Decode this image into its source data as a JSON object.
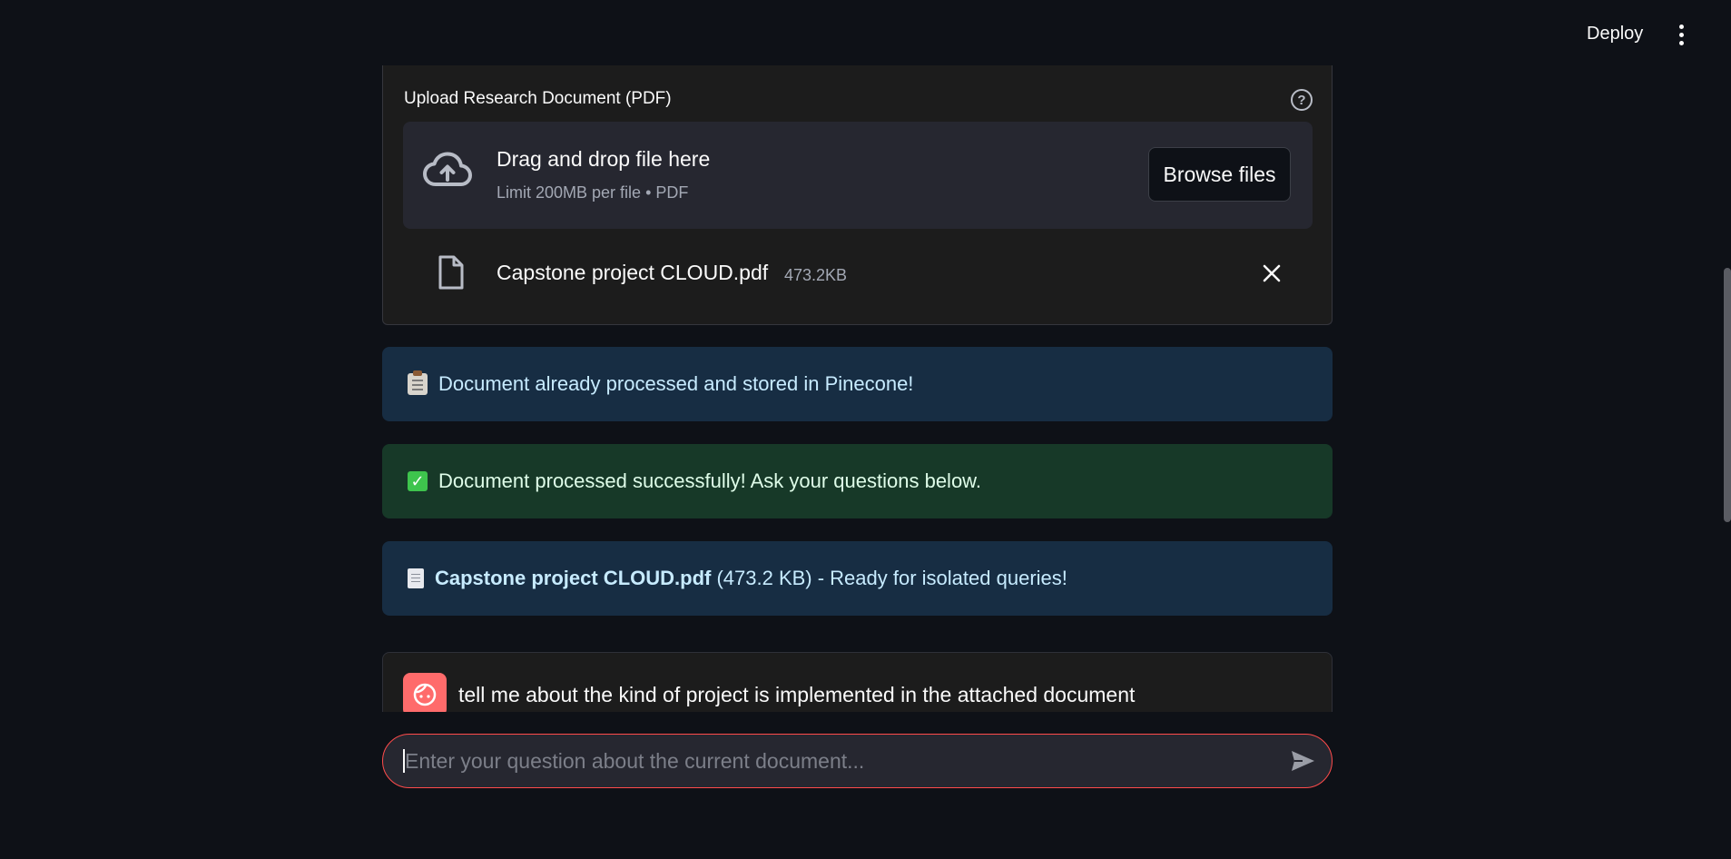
{
  "header": {
    "deploy_label": "Deploy",
    "menu_icon": "more-vertical-icon"
  },
  "uploader": {
    "label": "Upload Research Document (PDF)",
    "help_icon": "help-circle-icon",
    "dropzone_title": "Drag and drop file here",
    "dropzone_subtitle": "Limit 200MB per file • PDF",
    "browse_label": "Browse files",
    "cloud_icon": "cloud-upload-icon",
    "file": {
      "name": "Capstone project CLOUD.pdf",
      "size": "473.2KB",
      "icon": "file-icon",
      "remove_icon": "close-icon"
    }
  },
  "alerts": [
    {
      "type": "info",
      "icon": "clipboard-icon",
      "text": "Document already processed and stored in Pinecone!"
    },
    {
      "type": "success",
      "icon": "check-icon",
      "text": "Document processed successfully! Ask your questions below."
    },
    {
      "type": "info",
      "icon": "document-icon",
      "bold_text": "Capstone project CLOUD.pdf",
      "text": " (473.2 KB) - Ready for isolated queries!"
    }
  ],
  "chat": {
    "messages": [
      {
        "role": "user",
        "avatar_icon": "user-avatar-icon",
        "text": "tell me about the kind of project is implemented in the attached document"
      }
    ],
    "input_placeholder": "Enter your question about the current document...",
    "send_icon": "send-icon"
  },
  "colors": {
    "background": "#0e1117",
    "accent": "#ff4b4b",
    "info_bg": "#172d43",
    "success_bg": "#173928",
    "avatar_bg": "#ff6b6b"
  }
}
